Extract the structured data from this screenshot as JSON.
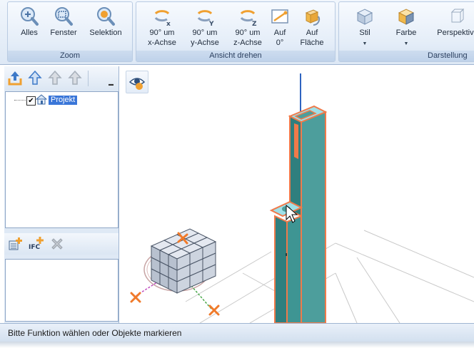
{
  "ribbon": {
    "zoom": {
      "label": "Zoom",
      "buttons": [
        {
          "line1": "Alles",
          "icon": "zoom-all-icon"
        },
        {
          "line1": "Fenster",
          "icon": "zoom-window-icon"
        },
        {
          "line1": "Selektion",
          "icon": "zoom-selection-icon"
        }
      ]
    },
    "rotate": {
      "label": "Ansicht drehen",
      "buttons": [
        {
          "line1": "90° um",
          "line2": "x-Achse",
          "icon": "rotate-x-icon"
        },
        {
          "line1": "90° um",
          "line2": "y-Achse",
          "icon": "rotate-y-icon"
        },
        {
          "line1": "90° um",
          "line2": "z-Achse",
          "icon": "rotate-z-icon"
        },
        {
          "line1": "Auf",
          "line2": "0°",
          "icon": "rotate-zero-icon"
        },
        {
          "line1": "Auf",
          "line2": "Fläche",
          "icon": "rotate-face-icon"
        }
      ]
    },
    "display": {
      "label": "Darstellung",
      "buttons": [
        {
          "line1": "Stil",
          "icon": "style-cube-icon"
        },
        {
          "line1": "Farbe",
          "icon": "color-cube-icon"
        },
        {
          "line1": "Perspektive",
          "icon": "perspective-cube-icon"
        }
      ]
    }
  },
  "tree": {
    "root_label": "Projekt",
    "root_checked": "✔"
  },
  "toolbar2": {
    "ifc_label": "IFC"
  },
  "status": {
    "text": "Bitte Funktion wählen oder Objekte markieren"
  }
}
